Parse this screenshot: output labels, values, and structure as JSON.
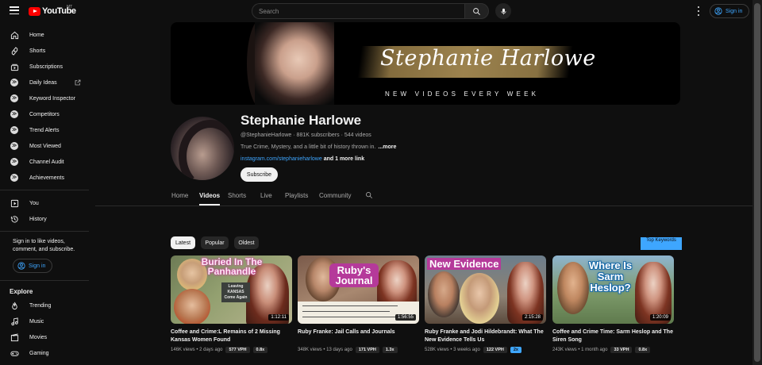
{
  "header": {
    "logo_text": "YouTube",
    "region": "MT",
    "search_placeholder": "Search",
    "signin_label": "Sign in"
  },
  "sidebar": {
    "items": [
      {
        "label": "Home",
        "icon": "home-icon"
      },
      {
        "label": "Shorts",
        "icon": "shorts-icon"
      },
      {
        "label": "Subscriptions",
        "icon": "subscriptions-icon"
      },
      {
        "label": "Daily Ideas",
        "icon": "extension-icon"
      },
      {
        "label": "Keyword Inspector",
        "icon": "extension-icon"
      },
      {
        "label": "Competitors",
        "icon": "extension-icon"
      },
      {
        "label": "Trend Alerts",
        "icon": "extension-icon"
      },
      {
        "label": "Most Viewed",
        "icon": "extension-icon"
      },
      {
        "label": "Channel Audit",
        "icon": "extension-icon"
      },
      {
        "label": "Achievements",
        "icon": "extension-icon"
      }
    ],
    "you": [
      {
        "label": "You",
        "icon": "you-icon"
      },
      {
        "label": "History",
        "icon": "history-icon"
      }
    ],
    "signin_prompt": "Sign in to like videos, comment, and subscribe.",
    "signin_label": "Sign in",
    "explore_title": "Explore",
    "explore": [
      {
        "label": "Trending",
        "icon": "trending-icon"
      },
      {
        "label": "Music",
        "icon": "music-icon"
      },
      {
        "label": "Movies",
        "icon": "movies-icon"
      },
      {
        "label": "Gaming",
        "icon": "gaming-icon"
      }
    ]
  },
  "banner": {
    "name": "Stephanie Harlowe",
    "tagline": "NEW VIDEOS EVERY WEEK"
  },
  "channel": {
    "name": "Stephanie Harlowe",
    "handle": "@StephanieHarlowe",
    "subscribers": "881K subscribers",
    "videos": "544 videos",
    "description": "True Crime, Mystery, and a little bit of history thrown in.",
    "more": "...more",
    "link": "instagram.com/stephanieharlowe",
    "more_links": "and 1 more link",
    "subscribe": "Subscribe"
  },
  "tabs": [
    "Home",
    "Videos",
    "Shorts",
    "Live",
    "Playlists",
    "Community"
  ],
  "active_tab": "Videos",
  "chips": [
    "Latest",
    "Popular",
    "Oldest"
  ],
  "top_keywords_label": "Top Keywords",
  "videos": [
    {
      "title": "Coffee and Crime:L Remains of 2 Missing Kansas Women Found",
      "views": "146K views",
      "age": "2 days ago",
      "vph": "577 VPH",
      "multiplier": "0.8x",
      "duration": "1:12:11",
      "thumb_text": "Buried In The Panhandle",
      "thumb_sign": "Leaving KANSAS Come Again"
    },
    {
      "title": "Ruby Franke: Jail Calls and Journals",
      "views": "348K views",
      "age": "13 days ago",
      "vph": "171 VPH",
      "multiplier": "1.3x",
      "duration": "1:56:55",
      "thumb_text": "Ruby's Journal"
    },
    {
      "title": "Ruby Franke and Jodi Hildebrandt: What The New Evidence Tells Us",
      "views": "528K views",
      "age": "3 weeks ago",
      "vph": "122 VPH",
      "multiplier": "2x",
      "duration": "2:15:28",
      "thumb_text": "New Evidence"
    },
    {
      "title": "Coffee and Crime Time: Sarm Heslop and The Siren Song",
      "views": "243K views",
      "age": "1 month ago",
      "vph": "33 VPH",
      "multiplier": "0.8x",
      "duration": "1:20:09",
      "thumb_text": "Where Is Sarm Heslop?"
    }
  ]
}
